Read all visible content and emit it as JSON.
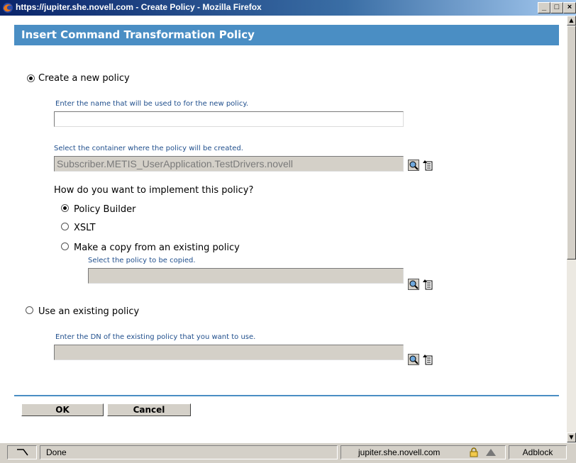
{
  "window": {
    "title": "https://jupiter.she.novell.com - Create Policy - Mozilla Firefox",
    "minimize_icon": "minimize-icon",
    "maximize_icon": "maximize-icon",
    "close_icon": "close-icon"
  },
  "dialog": {
    "header": "Insert Command Transformation Policy",
    "create_new": {
      "label": "Create a new policy",
      "checked": true,
      "name_hint": "Enter the name that will be used to for the new policy.",
      "name_value": "",
      "container_hint": "Select the container where the policy will be created.",
      "container_value": "Subscriber.METIS_UserApplication.TestDrivers.novell",
      "implement_question": "How do you want to implement this policy?",
      "options": [
        {
          "label": "Policy Builder",
          "checked": true
        },
        {
          "label": "XSLT",
          "checked": false
        },
        {
          "label": "Make a copy from an existing policy",
          "checked": false
        }
      ],
      "copy_hint": "Select the policy to be copied.",
      "copy_value": ""
    },
    "use_existing": {
      "label": "Use an existing policy",
      "checked": false,
      "dn_hint": "Enter the DN of the existing policy that you want to use.",
      "dn_value": ""
    },
    "buttons": {
      "ok": "OK",
      "cancel": "Cancel"
    }
  },
  "statusbar": {
    "status": "Done",
    "host": "jupiter.she.novell.com",
    "adblock": "Adblock"
  },
  "colors": {
    "header_bg": "#4a8ec4",
    "hint_text": "#1f4e8c",
    "disabled_field": "#d4d0c8"
  }
}
